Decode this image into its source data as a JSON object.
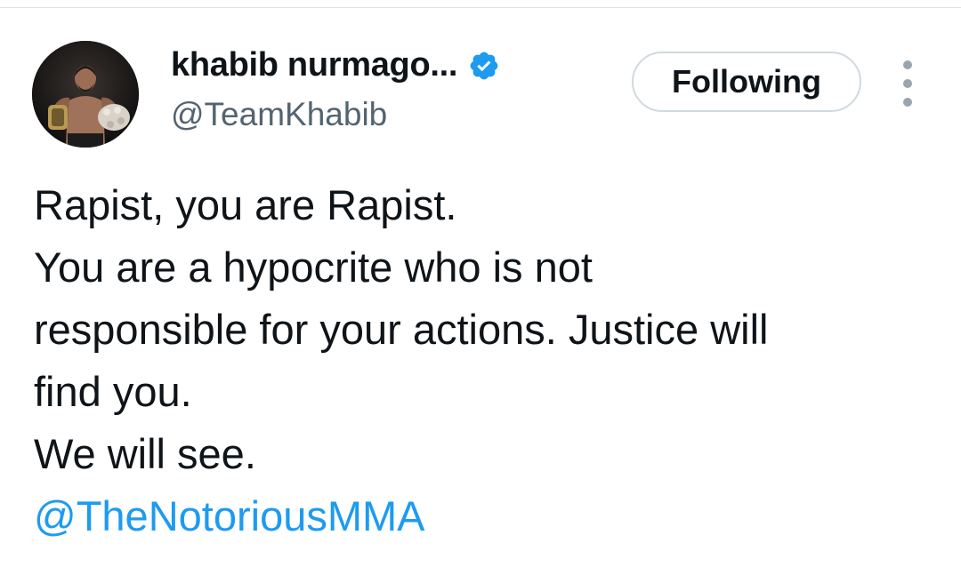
{
  "author": {
    "display_name": "khabib nurmago...",
    "handle": "@TeamKhabib",
    "verified_icon": "verified-badge-icon",
    "avatar_icon": "avatar"
  },
  "actions": {
    "follow_label": "Following",
    "more_icon": "more-options-icon"
  },
  "tweet": {
    "lines": [
      "Rapist, you are Rapist.",
      "You are a hypocrite who is not",
      "responsible for your actions. Justice will",
      "find you.",
      "We will see."
    ],
    "mention": "@TheNotoriousMMA"
  },
  "colors": {
    "text": "#0f1419",
    "secondary": "#536471",
    "accent": "#1d9bf0",
    "border": "#cfd9de"
  }
}
